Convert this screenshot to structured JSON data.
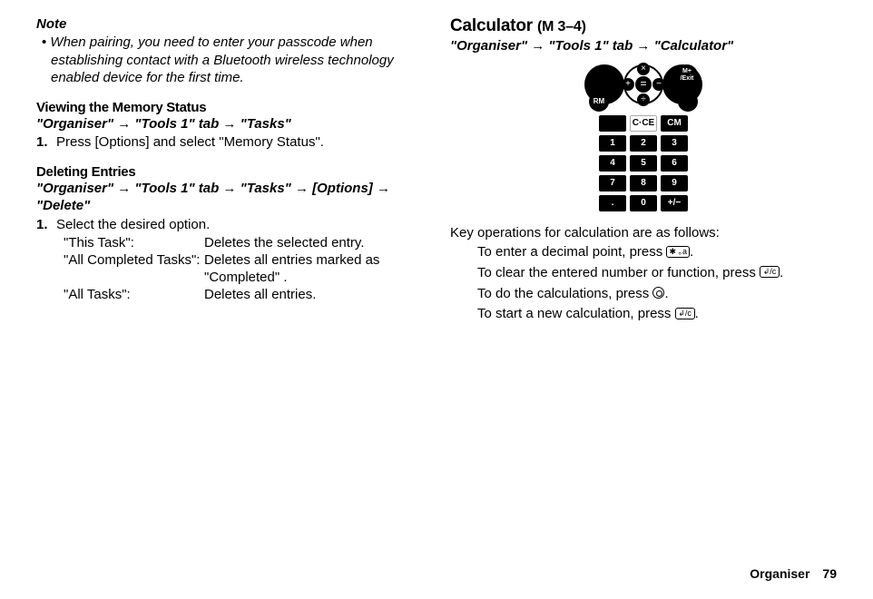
{
  "left": {
    "note_title": "Note",
    "note_body": "When pairing, you need to enter your passcode when establishing contact with a Bluetooth wireless technology enabled device for the first time.",
    "mem_heading": "Viewing the Memory Status",
    "mem_path": "\"Organiser\" → \"Tools 1\" tab → \"Tasks\"",
    "mem_step_num": "1.",
    "mem_step_text": "Press [Options] and select \"Memory Status\".",
    "del_heading": "Deleting Entries",
    "del_path": "\"Organiser\" → \"Tools 1\" tab → \"Tasks\" → [Options] → \"Delete\"",
    "del_step_num": "1.",
    "del_step_text": "Select the desired option.",
    "options": [
      {
        "key": "\"This Task\":",
        "val": "Deletes the selected entry."
      },
      {
        "key": "\"All Completed Tasks\":",
        "val": "Deletes all entries marked as \"Completed\" ."
      },
      {
        "key": "\"All Tasks\":",
        "val": "Deletes all entries."
      }
    ]
  },
  "right": {
    "heading": "Calculator",
    "mcode": "(M 3–4)",
    "path": "\"Organiser\" → \"Tools 1\" tab → \"Calculator\"",
    "intro": "Key operations for calculation are as follows:",
    "ops": {
      "decimal_a": "To enter a decimal point, press ",
      "decimal_b": ".",
      "decimal_key": "✱ ｡a",
      "clear_a": "To clear the entered number or function, press ",
      "clear_b": ".",
      "clear_key": "↲/c",
      "do_a": "To do the calculations, press ",
      "do_b": ".",
      "start_a": "To start a new calculation, press ",
      "start_b": ".",
      "start_key": "↲/c"
    },
    "calc_labels": {
      "rm": "RM",
      "mplus_a": "M+",
      "mplus_b": "/Exit",
      "x": "×",
      "d": "÷",
      "p": "+",
      "m": "−",
      "eq": "=",
      "cce": "C·CE",
      "cm": "CM"
    }
  },
  "footer": {
    "label": "Organiser",
    "page": "79"
  }
}
